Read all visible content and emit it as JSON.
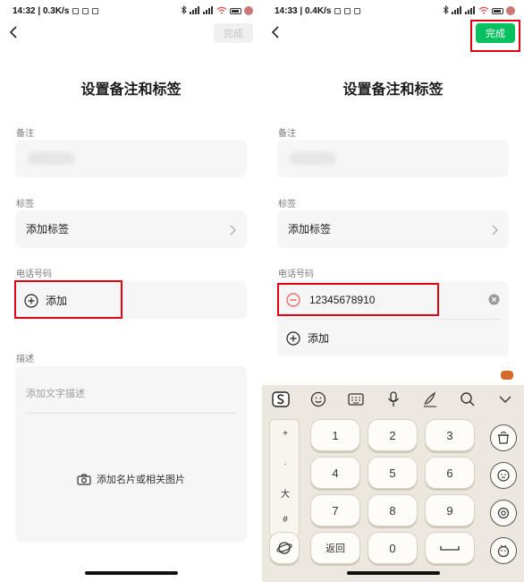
{
  "left": {
    "status": {
      "time": "14:32",
      "speed": "0.3K/s"
    },
    "done_label": "完成",
    "title": "设置备注和标签",
    "remark": {
      "label": "备注"
    },
    "tags": {
      "label": "标签",
      "value": "添加标签"
    },
    "phone": {
      "label": "电话号码",
      "add_label": "添加"
    },
    "description": {
      "label": "描述",
      "placeholder": "添加文字描述",
      "photo_label": "添加名片或相关图片"
    }
  },
  "right": {
    "status": {
      "time": "14:33",
      "speed": "0.4K/s"
    },
    "done_label": "完成",
    "title": "设置备注和标签",
    "remark": {
      "label": "备注"
    },
    "tags": {
      "label": "标签",
      "value": "添加标签"
    },
    "phone": {
      "label": "电话号码",
      "number": "12345678910",
      "add_label": "添加"
    }
  },
  "keyboard": {
    "keys": [
      "1",
      "2",
      "3",
      "4",
      "5",
      "6",
      "7",
      "8",
      "9",
      "返回",
      "0"
    ],
    "side_symbols": [
      "+",
      ".",
      "大",
      "#"
    ]
  },
  "colors": {
    "accent_green": "#07c160",
    "highlight_red": "#e60012",
    "field_bg": "#f6f6f6",
    "remove_red": "#f35a5a"
  }
}
